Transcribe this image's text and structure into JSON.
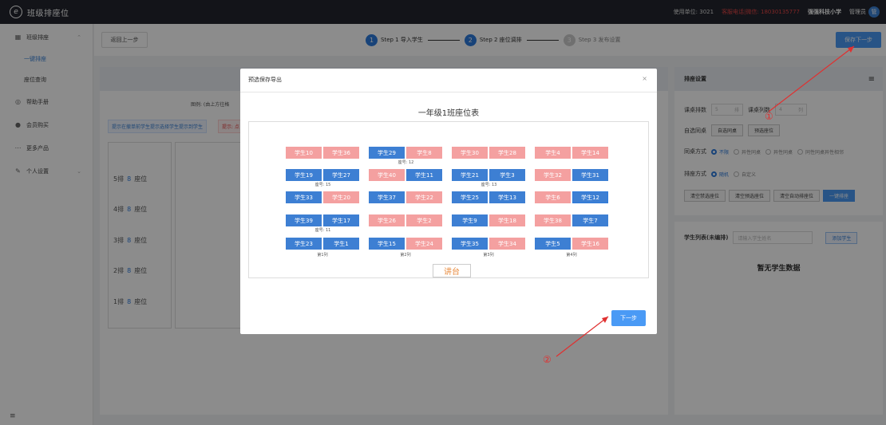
{
  "app": {
    "title": "班级排座位",
    "unit_label": "使用单位: 3021",
    "hotline": "客服电话|微信: 18030135777",
    "school": "强强科技小学",
    "admin": "管理员",
    "avatar_text": "管"
  },
  "sidebar": {
    "items": [
      {
        "label": "班级排座",
        "icon": "grid-icon"
      },
      {
        "label": "一键排座"
      },
      {
        "label": "座位查询"
      },
      {
        "label": "帮助手册",
        "icon": "help-icon"
      },
      {
        "label": "会员购买",
        "icon": "user-icon"
      },
      {
        "label": "更多产品",
        "icon": "more-icon"
      },
      {
        "label": "个人设置",
        "icon": "edit-icon"
      }
    ],
    "bottom": "≡"
  },
  "stepbar": {
    "back": "返回上一步",
    "steps": [
      {
        "num": "1",
        "label": "Step 1 导入学生"
      },
      {
        "num": "2",
        "label": "Step 2 座位调排"
      },
      {
        "num": "3",
        "label": "Step 3 发布设置"
      }
    ],
    "save_next": "保存下一步"
  },
  "workspace": {
    "legend": "图例:  (由上方往格",
    "tip_blue": "提示在撤单前学生提示选择学生提示到学生",
    "tip_red": "提示: 点",
    "rows": [
      {
        "label": "5排",
        "count": "8",
        "suffix": "座位"
      },
      {
        "label": "4排",
        "count": "8",
        "suffix": "座位"
      },
      {
        "label": "3排",
        "count": "8",
        "suffix": "座位"
      },
      {
        "label": "2排",
        "count": "8",
        "suffix": "座位"
      },
      {
        "label": "1排",
        "count": "8",
        "suffix": "座位"
      }
    ]
  },
  "settings": {
    "title": "排座设置",
    "rows_label": "课桌排数",
    "rows_value": "5",
    "rows_unit": "排",
    "cols_label": "课桌列数",
    "cols_value": "4",
    "cols_unit": "列",
    "choose_label": "自选同桌",
    "choose_btn1": "自选同桌",
    "choose_btn2": "预选座位",
    "mode_label": "同桌方式",
    "mode_opts": [
      "不限",
      "异性同桌",
      "异性同桌",
      "同性同桌异性相邻"
    ],
    "arrange_label": "排座方式",
    "arrange_opts": [
      "随机",
      "自定义"
    ],
    "btn_clear_sel": "清空禁选座位",
    "btn_clear_pre": "清空预选座位",
    "btn_clear_auto": "清空自动排座位",
    "btn_one_key": "一键排座",
    "student_list": "学生列表(未编排)",
    "search_placeholder": "请输入学生姓名",
    "add_student": "添加学生",
    "empty": "暂无学生数据"
  },
  "modal": {
    "title": "预选保存导出",
    "close": "×",
    "heading": "一年级1班座位表",
    "podium": "讲台",
    "next": "下一步",
    "desk_labels": [
      {
        "text": "座号: 12",
        "col": 1,
        "row": 0
      },
      {
        "text": "座号: 15",
        "col": 0,
        "row": 1
      },
      {
        "text": "座号: 13",
        "col": 2,
        "row": 1
      },
      {
        "text": "座号: 11",
        "col": 0,
        "row": 3
      }
    ],
    "col_labels": [
      "第1列",
      "第2列",
      "第3列",
      "第4列"
    ],
    "seats": [
      [
        [
          "学生10",
          "p"
        ],
        [
          "学生36",
          "p"
        ],
        [
          "学生29",
          "b"
        ],
        [
          "学生8",
          "p"
        ],
        [
          "学生30",
          "p"
        ],
        [
          "学生28",
          "p"
        ],
        [
          "学生4",
          "p"
        ],
        [
          "学生14",
          "p"
        ]
      ],
      [
        [
          "学生19",
          "b"
        ],
        [
          "学生27",
          "b"
        ],
        [
          "学生40",
          "p"
        ],
        [
          "学生11",
          "b"
        ],
        [
          "学生21",
          "b"
        ],
        [
          "学生3",
          "b"
        ],
        [
          "学生32",
          "p"
        ],
        [
          "学生31",
          "b"
        ]
      ],
      [
        [
          "学生33",
          "b"
        ],
        [
          "学生20",
          "p"
        ],
        [
          "学生37",
          "b"
        ],
        [
          "学生22",
          "p"
        ],
        [
          "学生25",
          "b"
        ],
        [
          "学生13",
          "b"
        ],
        [
          "学生6",
          "p"
        ],
        [
          "学生12",
          "sel"
        ]
      ],
      [
        [
          "学生39",
          "b"
        ],
        [
          "学生17",
          "b"
        ],
        [
          "学生26",
          "p"
        ],
        [
          "学生2",
          "p"
        ],
        [
          "学生9",
          "b"
        ],
        [
          "学生18",
          "p"
        ],
        [
          "学生38",
          "p"
        ],
        [
          "学生7",
          "b"
        ]
      ],
      [
        [
          "学生23",
          "b"
        ],
        [
          "学生1",
          "b"
        ],
        [
          "学生15",
          "b"
        ],
        [
          "学生24",
          "p"
        ],
        [
          "学生35",
          "b"
        ],
        [
          "学生34",
          "p"
        ],
        [
          "学生5",
          "b"
        ],
        [
          "学生16",
          "p"
        ]
      ]
    ]
  },
  "annotations": {
    "one": "①",
    "two": "②"
  }
}
